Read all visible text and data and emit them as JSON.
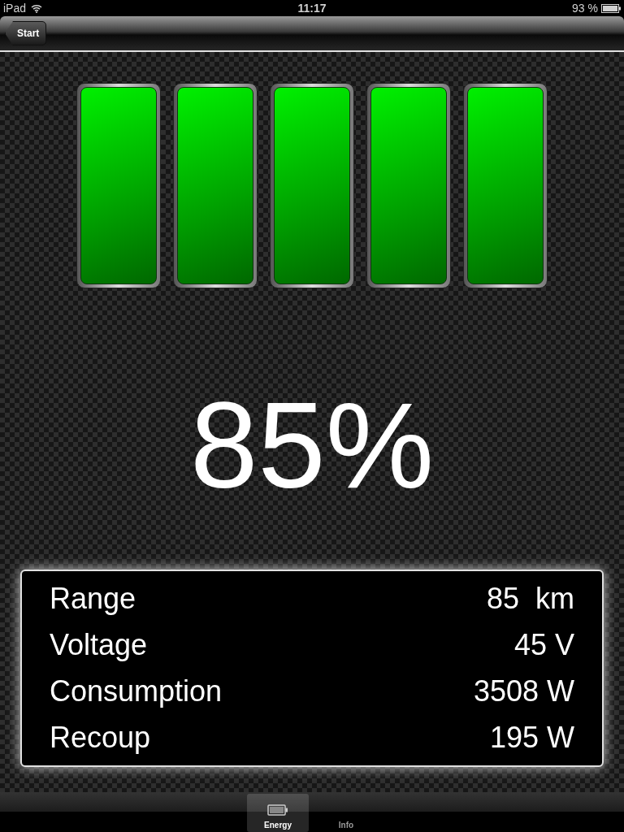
{
  "status_bar": {
    "carrier": "iPad",
    "time": "11:17",
    "battery": "93 %"
  },
  "nav_bar": {
    "back_button": "Start"
  },
  "segments": [
    {
      "on": true
    },
    {
      "on": true
    },
    {
      "on": true
    },
    {
      "on": true
    },
    {
      "on": true
    }
  ],
  "percentage": "85%",
  "readings": [
    {
      "label": "Range",
      "value": "85  km"
    },
    {
      "label": "Voltage",
      "value": "45 V"
    },
    {
      "label": "Consumption",
      "value": "3508 W"
    },
    {
      "label": "Recoup",
      "value": "195 W"
    }
  ],
  "tab_bar": [
    {
      "label": "Energy",
      "selected": true
    },
    {
      "label": "Info",
      "selected": false
    }
  ]
}
